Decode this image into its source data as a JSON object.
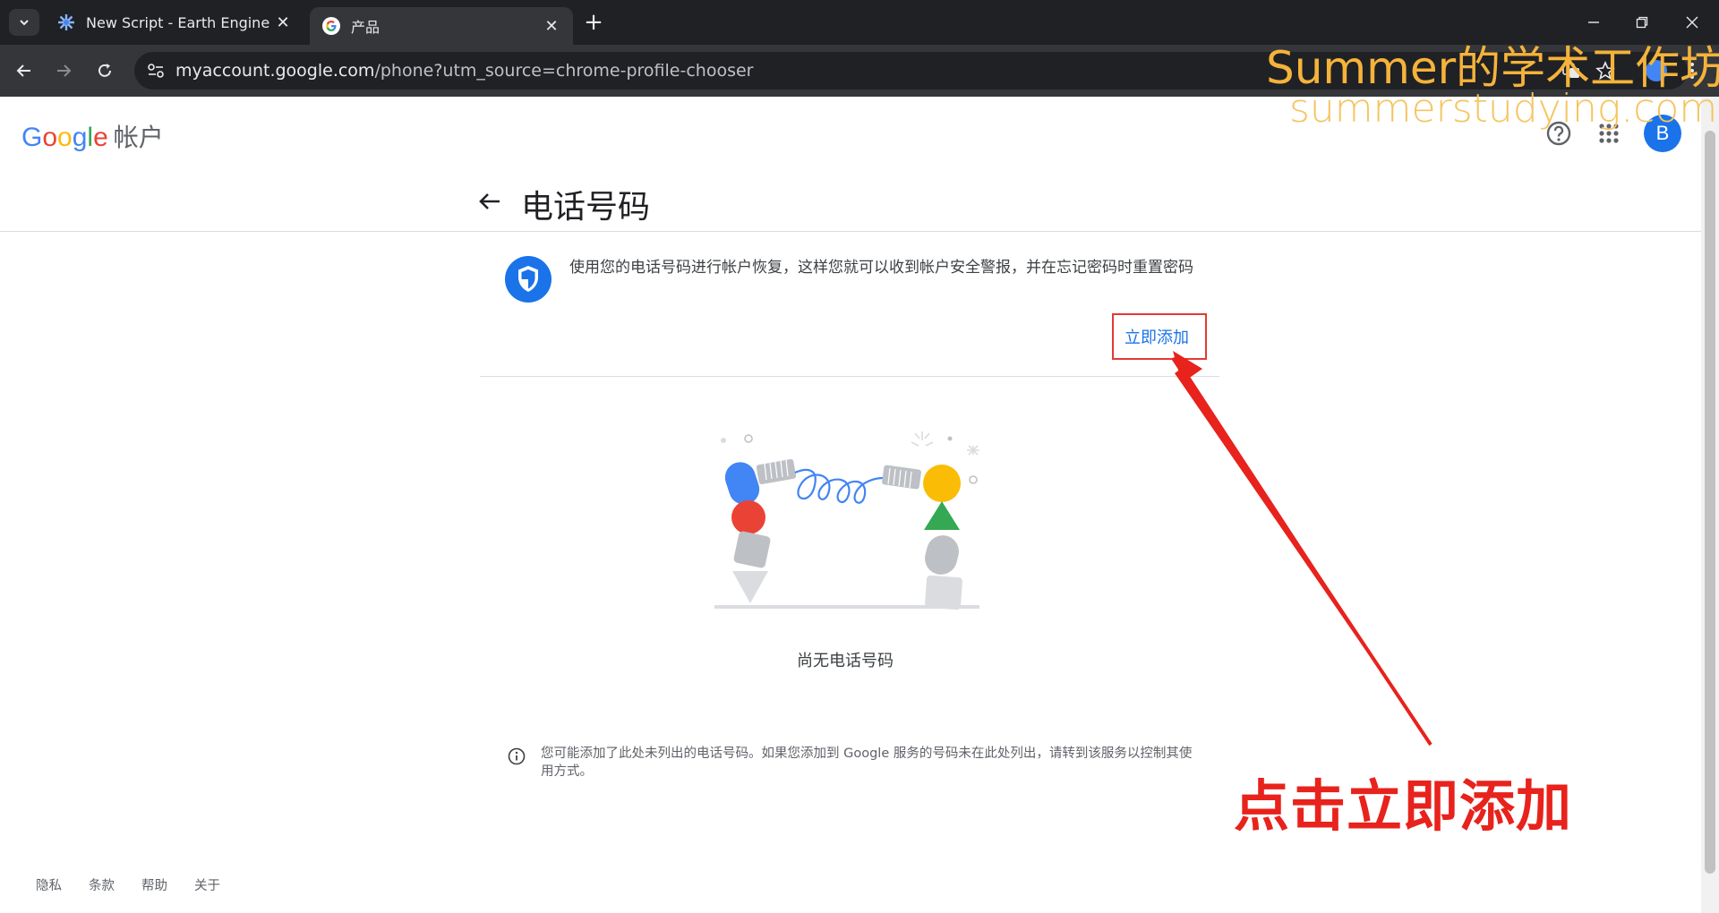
{
  "browser": {
    "tabs": [
      {
        "title": "New Script - Earth Engine Co",
        "icon": "earth-engine-icon"
      },
      {
        "title": "产品",
        "icon": "google-g-icon"
      }
    ],
    "url": {
      "host": "myaccount.google.com",
      "path": "/phone?utm_source=chrome-profile-chooser"
    }
  },
  "watermark": {
    "line1": "Summer的学术工作坊",
    "line2": "summerstudying.com"
  },
  "header": {
    "logo_google": "Google",
    "logo_product": "帐户",
    "avatar_letter": "B"
  },
  "main": {
    "title": "电话号码",
    "info_text": "使用您的电话号码进行帐户恢复，这样您就可以收到帐户安全警报，并在忘记密码时重置密码",
    "add_button": "立即添加",
    "empty_state": "尚无电话号码",
    "note": "您可能添加了此处未列出的电话号码。如果您添加到 Google 服务的号码未在此处列出，请转到该服务以控制其使用方式。"
  },
  "footer": {
    "links": [
      "隐私",
      "条款",
      "帮助",
      "关于"
    ]
  },
  "annotation": "点击立即添加",
  "colors": {
    "accent": "#1a73e8",
    "annotation_red": "#e8221c",
    "watermark": "#f5b33a"
  }
}
